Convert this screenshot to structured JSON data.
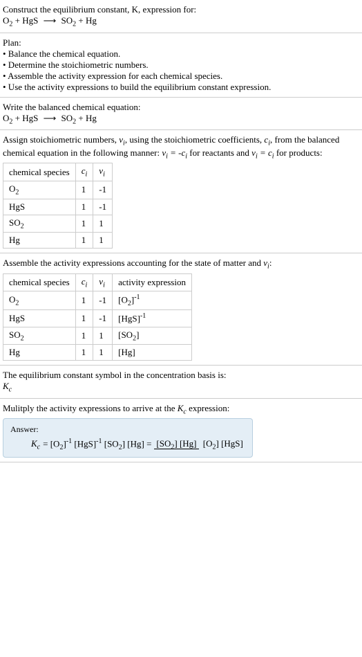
{
  "s1": {
    "line1": "Construct the equilibrium constant, K, expression for:",
    "eq_left1": "O",
    "eq_left1_sub": "2",
    "eq_left2": "HgS",
    "eq_right1": "SO",
    "eq_right1_sub": "2",
    "eq_right2": "Hg"
  },
  "s2": {
    "h": "Plan:",
    "b1": "• Balance the chemical equation.",
    "b2": "• Determine the stoichiometric numbers.",
    "b3": "• Assemble the activity expression for each chemical species.",
    "b4": "• Use the activity expressions to build the equilibrium constant expression."
  },
  "s3": {
    "h": "Write the balanced chemical equation:"
  },
  "s4": {
    "p1a": "Assign stoichiometric numbers, ",
    "p1b": ", using the stoichiometric coefficients, ",
    "p1c": ", from the balanced chemical equation in the following manner: ",
    "p1d": " for reactants and ",
    "p1e": " for products:",
    "th1": "chemical species",
    "r1c1a": "O",
    "r1c1b": "2",
    "r1c2": "1",
    "r1c3": "-1",
    "r2c1": "HgS",
    "r2c2": "1",
    "r2c3": "-1",
    "r3c1a": "SO",
    "r3c1b": "2",
    "r3c2": "1",
    "r3c3": "1",
    "r4c1": "Hg",
    "r4c2": "1",
    "r4c3": "1"
  },
  "s5": {
    "p1a": "Assemble the activity expressions accounting for the state of matter and ",
    "p1b": ":",
    "th1": "chemical species",
    "th4": "activity expression",
    "r1c3": "-1",
    "r2c3": "-1",
    "r3c3": "1",
    "r4c3": "1",
    "r1c2": "1",
    "r2c2": "1",
    "r3c2": "1",
    "r4c2": "1"
  },
  "s6": {
    "l1": "The equilibrium constant symbol in the concentration basis is:"
  },
  "s7": {
    "l1a": "Mulitply the activity expressions to arrive at the ",
    "l1b": " expression:",
    "ans": "Answer:"
  }
}
